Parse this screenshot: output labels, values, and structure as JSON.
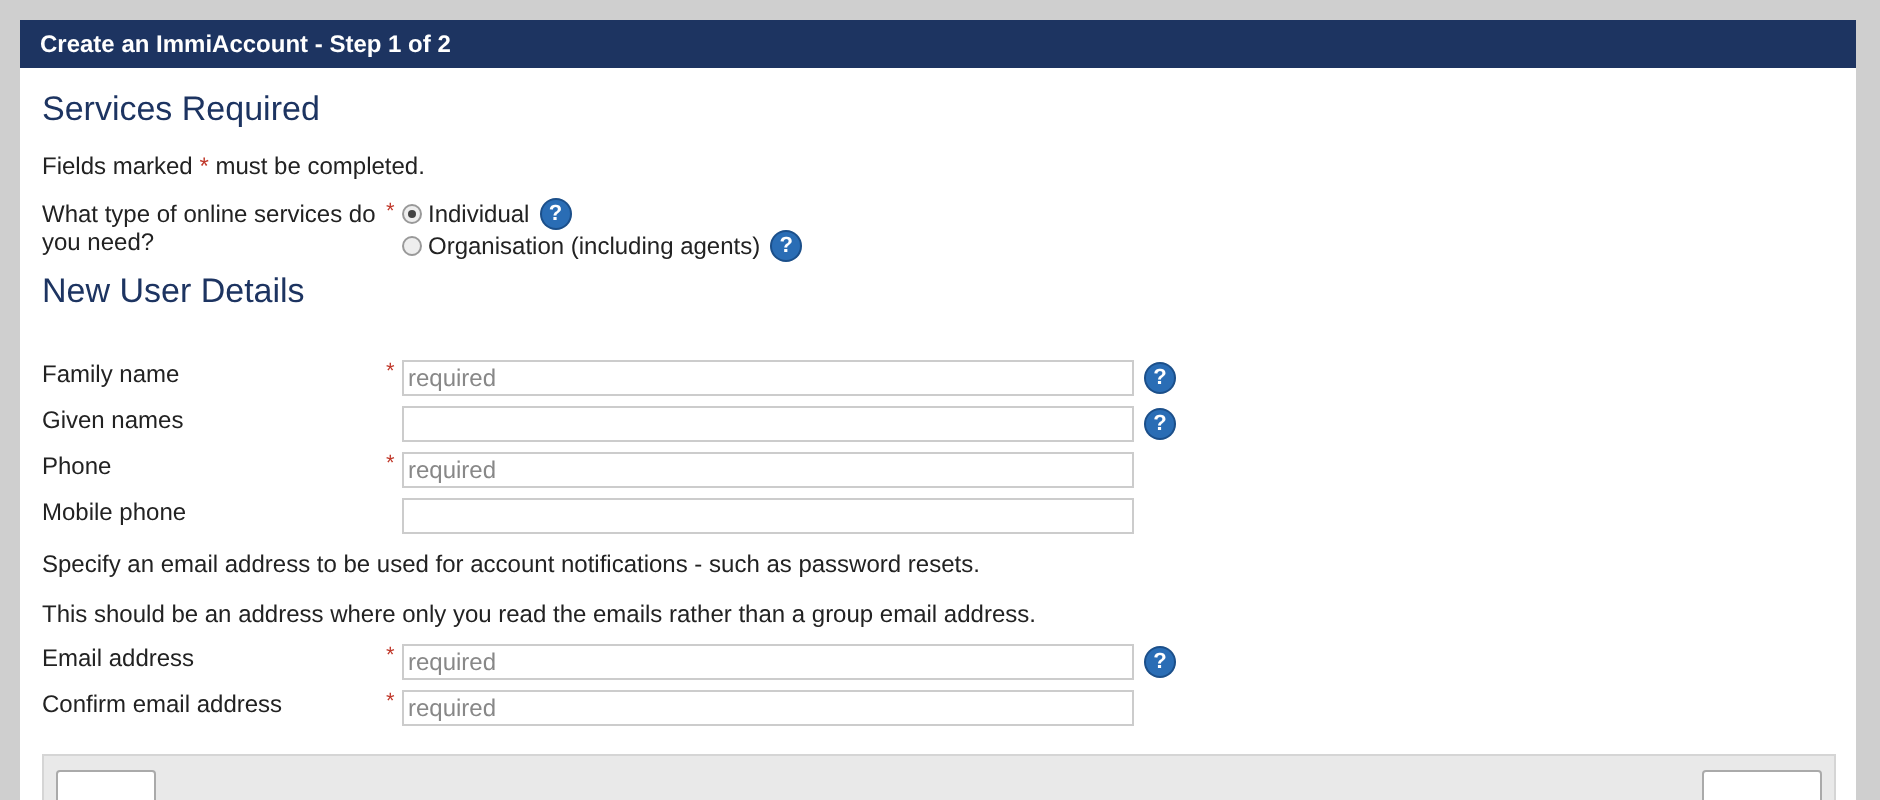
{
  "window": {
    "title": "Create an ImmiAccount - Step 1 of 2"
  },
  "services": {
    "heading": "Services Required",
    "note": {
      "before": "Fields marked ",
      "mark": "*",
      "after": " must be completed."
    },
    "question": {
      "label": "What type of online services do you need?",
      "mark": "*",
      "options": [
        {
          "label": "Individual",
          "selected": true,
          "help": "?"
        },
        {
          "label": "Organisation (including agents)",
          "selected": false,
          "help": "?"
        }
      ]
    }
  },
  "user_details": {
    "heading": "New User Details",
    "rows": [
      {
        "kind": "field",
        "label": "Family name",
        "mark": "*",
        "placeholder": "required",
        "help": "?"
      },
      {
        "kind": "field",
        "label": "Given names",
        "help": "?"
      },
      {
        "kind": "field",
        "label": "Phone",
        "mark": "*",
        "placeholder": "required"
      },
      {
        "kind": "field",
        "label": "Mobile phone"
      },
      {
        "kind": "text",
        "text": "Specify an email address to be used for account notifications - such as password resets."
      },
      {
        "kind": "text",
        "text": "This should be an address where only you read the emails rather than a group email address."
      },
      {
        "kind": "field",
        "label": "Email address",
        "mark": "*",
        "placeholder": "required",
        "help": "?"
      },
      {
        "kind": "field",
        "label": "Confirm email address",
        "mark": "*",
        "placeholder": "required"
      }
    ]
  }
}
